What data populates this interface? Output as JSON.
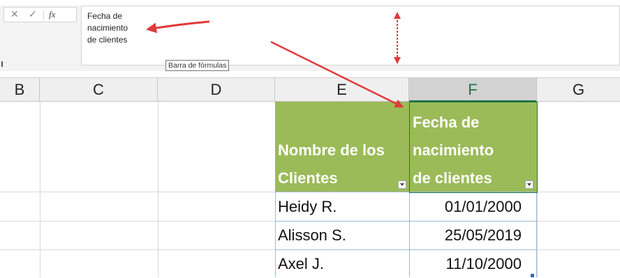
{
  "formula_bar": {
    "cancel_icon": "close-icon",
    "enter_icon": "check-icon",
    "cancel_glyph": "✕",
    "enter_glyph": "✓",
    "fx_label": "fx",
    "content": "Fecha de\nnacimiento\nde clientes",
    "tooltip": "Barra de fórmulas"
  },
  "columns": [
    "B",
    "C",
    "D",
    "E",
    "F",
    "G"
  ],
  "selected_column": "F",
  "table": {
    "headers": [
      "Nombre de los\nClientes",
      "Fecha de\nnacimiento\nde clientes"
    ],
    "rows": [
      [
        "Heidy R.",
        "01/01/2000"
      ],
      [
        "Alisson S.",
        "25/05/2019"
      ],
      [
        "Axel J.",
        "11/10/2000"
      ]
    ]
  },
  "colors": {
    "header_fill": "#9bbb59",
    "header_text": "#ffffff",
    "selection": "#217346",
    "annotation_arrow": "#e03a3a"
  }
}
